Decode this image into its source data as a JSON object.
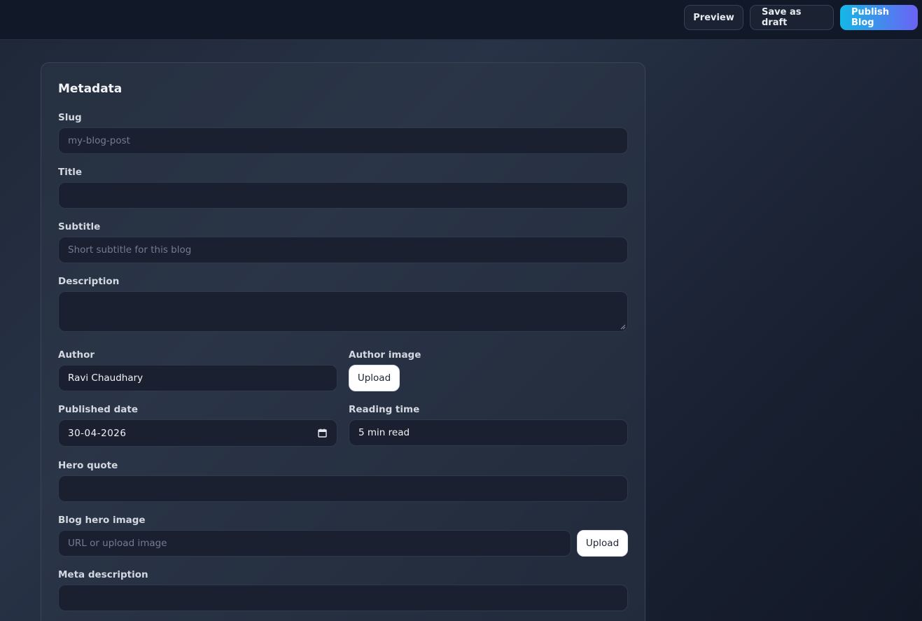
{
  "header": {
    "preview_label": "Preview",
    "save_draft_label": "Save as draft",
    "publish_label": "Publish Blog"
  },
  "metadata": {
    "title": "Metadata",
    "slug": {
      "label": "Slug",
      "placeholder": "my-blog-post",
      "value": ""
    },
    "title_field": {
      "label": "Title",
      "value": ""
    },
    "subtitle": {
      "label": "Subtitle",
      "placeholder": "Short subtitle for this blog",
      "value": ""
    },
    "description": {
      "label": "Description",
      "value": ""
    },
    "author": {
      "label": "Author",
      "value": "Ravi Chaudhary"
    },
    "author_image": {
      "label": "Author image",
      "upload_label": "Upload"
    },
    "published_date": {
      "label": "Published date",
      "value": "30-04-2026"
    },
    "reading_time": {
      "label": "Reading time",
      "value": "5 min read"
    },
    "hero_quote": {
      "label": "Hero quote",
      "value": ""
    },
    "blog_hero_image": {
      "label": "Blog hero image",
      "placeholder": "URL or upload image",
      "upload_label": "Upload"
    },
    "meta_description": {
      "label": "Meta description",
      "value": ""
    }
  },
  "icons": {
    "calendar": "calendar-icon",
    "resize": "resize-handle-icon"
  },
  "colors": {
    "accent_start": "#14b8e6",
    "accent_end": "#6b63f5",
    "field_bg": "#1a2030"
  }
}
